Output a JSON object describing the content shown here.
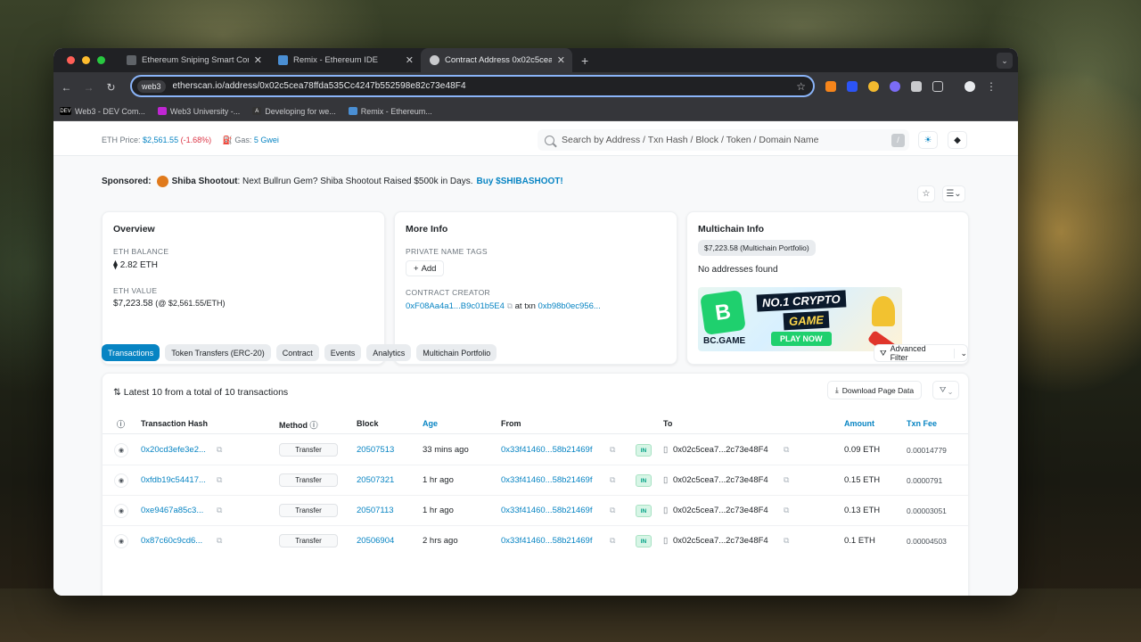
{
  "browser": {
    "tabs": [
      {
        "title": "Ethereum Sniping Smart Con",
        "color": "#9aa0a6"
      },
      {
        "title": "Remix - Ethereum IDE",
        "color": "#4a8fd4"
      },
      {
        "title": "Contract Address 0x02c5cea",
        "color": "#9aa0a6"
      }
    ],
    "site_chip": "web3",
    "url": "etherscan.io/address/0x02c5cea78ffda535Cc4247b552598e82c73e48F4",
    "bookmarks": [
      {
        "label": "Web3 - DEV Com...",
        "badge": "DEV",
        "color": "#000000"
      },
      {
        "label": "Web3 University -...",
        "badge": "",
        "color": "#c026d3"
      },
      {
        "label": "Developing for we...",
        "badge": "A",
        "color": "#333333"
      },
      {
        "label": "Remix - Ethereum...",
        "badge": "",
        "color": "#4a8fd4"
      }
    ]
  },
  "header": {
    "eth_price_label": "ETH Price:",
    "eth_price": "$2,561.55",
    "eth_change": "(-1.68%)",
    "gas_label": "Gas:",
    "gas": "5 Gwei",
    "search_placeholder": "Search by Address / Txn Hash / Block / Token / Domain Name",
    "slash": "/"
  },
  "sponsored": {
    "label": "Sponsored:",
    "name": "Shiba Shootout",
    "text": ": Next Bullrun Gem? Shiba Shootout Raised $500k in Days.",
    "cta": "Buy $SHIBASHOOT!"
  },
  "overview": {
    "title": "Overview",
    "balance_label": "ETH BALANCE",
    "balance": "2.82 ETH",
    "value_label": "ETH VALUE",
    "value": "$7,223.58",
    "value_rate": "(@ $2,561.55/ETH)"
  },
  "more_info": {
    "title": "More Info",
    "tags_label": "PRIVATE NAME TAGS",
    "add_label": "Add",
    "creator_label": "CONTRACT CREATOR",
    "creator": "0xF08Aa4a1...B9c01b5E4",
    "at_txn": "at txn",
    "txn": "0xb98b0ec956..."
  },
  "multichain": {
    "title": "Multichain Info",
    "portfolio": "$7,223.58 (Multichain Portfolio)",
    "no_addresses": "No addresses found",
    "ad": {
      "brand": "BC.GAME",
      "line1": "NO.1 CRYPTO",
      "line2": "GAME",
      "play": "PLAY NOW"
    }
  },
  "tabs": [
    "Transactions",
    "Token Transfers (ERC-20)",
    "Contract",
    "Events",
    "Analytics",
    "Multichain Portfolio"
  ],
  "advanced_filter": "Advanced Filter",
  "table": {
    "summary": "Latest 10 from a total of 10 transactions",
    "download": "Download Page Data",
    "columns": {
      "hash": "Transaction Hash",
      "method": "Method",
      "block": "Block",
      "age": "Age",
      "from": "From",
      "to": "To",
      "amount": "Amount",
      "fee": "Txn Fee"
    },
    "rows": [
      {
        "hash": "0x20cd3efe3e2...",
        "method": "Transfer",
        "block": "20507513",
        "age": "33 mins ago",
        "from": "0x33f41460...58b21469f",
        "dir": "IN",
        "to": "0x02c5cea7...2c73e48F4",
        "amount": "0.09 ETH",
        "fee": "0.00014779"
      },
      {
        "hash": "0xfdb19c54417...",
        "method": "Transfer",
        "block": "20507321",
        "age": "1 hr ago",
        "from": "0x33f41460...58b21469f",
        "dir": "IN",
        "to": "0x02c5cea7...2c73e48F4",
        "amount": "0.15 ETH",
        "fee": "0.0000791"
      },
      {
        "hash": "0xe9467a85c3...",
        "method": "Transfer",
        "block": "20507113",
        "age": "1 hr ago",
        "from": "0x33f41460...58b21469f",
        "dir": "IN",
        "to": "0x02c5cea7...2c73e48F4",
        "amount": "0.13 ETH",
        "fee": "0.00003051"
      },
      {
        "hash": "0x87c60c9cd6...",
        "method": "Transfer",
        "block": "20506904",
        "age": "2 hrs ago",
        "from": "0x33f41460...58b21469f",
        "dir": "IN",
        "to": "0x02c5cea7...2c73e48F4",
        "amount": "0.1 ETH",
        "fee": "0.00004503"
      }
    ]
  },
  "colors": {
    "accent": "#0784c3",
    "negative": "#dc3545",
    "in_badge": "#00a186"
  }
}
